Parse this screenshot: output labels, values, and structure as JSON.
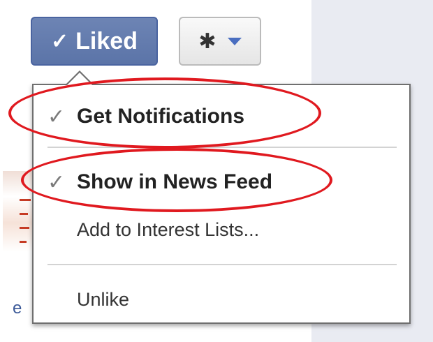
{
  "buttons": {
    "liked": {
      "check": "✓",
      "label": "Liked"
    },
    "settings": {
      "icon": "gear-icon",
      "chevron": "chevron-down-icon"
    }
  },
  "menu": {
    "items": [
      {
        "label": "Get Notifications",
        "checked": true,
        "check": "✓"
      },
      {
        "label": "Show in News Feed",
        "checked": true,
        "check": "✓"
      },
      {
        "label": "Add to Interest Lists..."
      },
      {
        "label": "Unlike"
      }
    ]
  },
  "background": {
    "edge_text": "e"
  },
  "colors": {
    "liked_button": "#5b74a8",
    "highlight_ellipse": "#e0191f",
    "chevron": "#4a6ec0"
  }
}
